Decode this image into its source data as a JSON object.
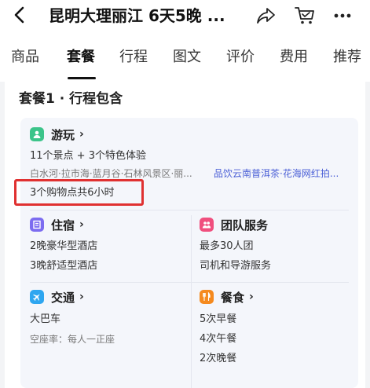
{
  "header": {
    "back_icon": "chevron-left-icon",
    "title": "昆明大理丽江 6天5晚 ...",
    "share_icon": "share-icon",
    "cart_icon": "shopping-cart-icon",
    "more_icon": "more-dots-icon"
  },
  "tabs": [
    {
      "label": "商品"
    },
    {
      "label": "套餐",
      "active": true
    },
    {
      "label": "行程"
    },
    {
      "label": "图文"
    },
    {
      "label": "评价"
    },
    {
      "label": "费用"
    },
    {
      "label": "推荐"
    }
  ],
  "package": {
    "section_title": "套餐1 · 行程包含",
    "play": {
      "label": "游玩",
      "icon": "play-icon",
      "icon_color": "#3cc48a",
      "summary": "11个景点 + 3个特色体验",
      "spots": "白水河·拉市海·蓝月谷·石林风景区·丽...",
      "experience": "品饮云南普洱茶·花海网红拍...",
      "shopping": "3个购物点共6小时"
    },
    "hotel": {
      "label": "住宿",
      "icon": "hotel-icon",
      "icon_color": "#7c6cf0",
      "line1": "2晚豪华型酒店",
      "line2": "3晚舒适型酒店"
    },
    "group": {
      "label": "团队服务",
      "icon": "group-service-icon",
      "icon_color": "#f04f7e",
      "line1": "最多30人团",
      "line2": "司机和导游服务"
    },
    "transport": {
      "label": "交通",
      "icon": "airplane-icon",
      "icon_color": "#2ea6f0",
      "line1": "大巴车",
      "line2": "空座率：每人一正座"
    },
    "meal": {
      "label": "餐食",
      "icon": "meal-icon",
      "icon_color": "#f58a1f",
      "line1": "5次早餐",
      "line2": "4次午餐",
      "line3": "2次晚餐"
    }
  },
  "annotation_color": "#e03131"
}
